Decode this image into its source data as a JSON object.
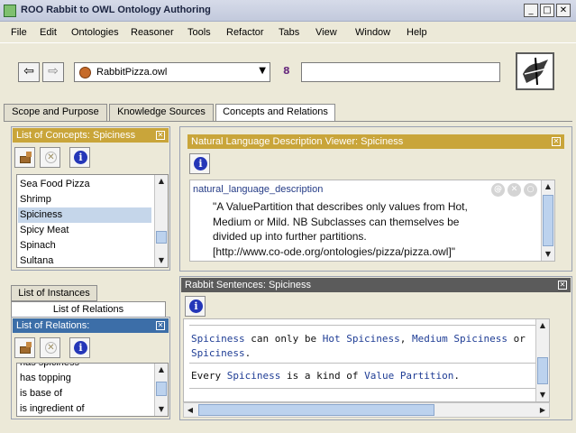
{
  "window": {
    "title": "ROO Rabbit to OWL Ontology Authoring",
    "controls": [
      "_",
      "□",
      "✕"
    ]
  },
  "menu": [
    "File",
    "Edit",
    "Ontologies",
    "Reasoner",
    "Tools",
    "Refactor",
    "Tabs",
    "View",
    "Window",
    "Help"
  ],
  "toolbar": {
    "back_icon": "⇦",
    "forward_icon": "⇨",
    "ontology_selected": "RabbitPizza.owl",
    "search_placeholder": "",
    "icons": [
      "back-arrow-icon",
      "forward-arrow-icon",
      "ontology-icon",
      "binoculars-icon",
      "logo-icon"
    ]
  },
  "tabs": [
    {
      "label": "Scope and Purpose",
      "active": false
    },
    {
      "label": "Knowledge Sources",
      "active": false
    },
    {
      "label": "Concepts and Relations",
      "active": true
    }
  ],
  "concepts_panel": {
    "title": "List of Concepts: Spiciness",
    "items": [
      "Sea Food Pizza",
      "Shrimp",
      "Spiciness",
      "Spicy Meat",
      "Spinach",
      "Sultana"
    ],
    "selected": "Spiciness"
  },
  "lower_tabs": {
    "instances_label": "List of Instances",
    "relations_label": "List of Relations"
  },
  "relations_panel": {
    "title": "List of Relations:",
    "items": [
      "has spiciness",
      "has topping",
      "is base of",
      "is ingredient of"
    ]
  },
  "nl_viewer": {
    "title": "Natural Language Description Viewer: Spiciness",
    "property": "natural_language_description",
    "lines": [
      "\"A ValuePartition that describes only values from Hot,",
      "Medium or Mild. NB Subclasses can themselves be",
      "divided up into further partitions.",
      "[http://www.co-ode.org/ontologies/pizza/pizza.owl]\""
    ],
    "circle_icons": [
      "@",
      "✕",
      "○"
    ]
  },
  "rabbit_panel": {
    "title": "Rabbit Sentences: Spiciness",
    "sentence1": {
      "t1": "Spiciness",
      "t2": " can only be ",
      "t3": "Hot Spiciness",
      "t4": ", ",
      "t5": "Medium Spiciness",
      "t6": " or",
      "t7": "Spiciness",
      "t8": "."
    },
    "sentence2": {
      "t1": "Every ",
      "t2": "Spiciness",
      "t3": " is a kind of ",
      "t4": "Value Partition",
      "t5": "."
    }
  },
  "colors": {
    "gold_header": "#c9a53a",
    "blue_header": "#3c6ea8",
    "dark_header": "#5b5b5b",
    "keyword": "#1f3d95"
  }
}
